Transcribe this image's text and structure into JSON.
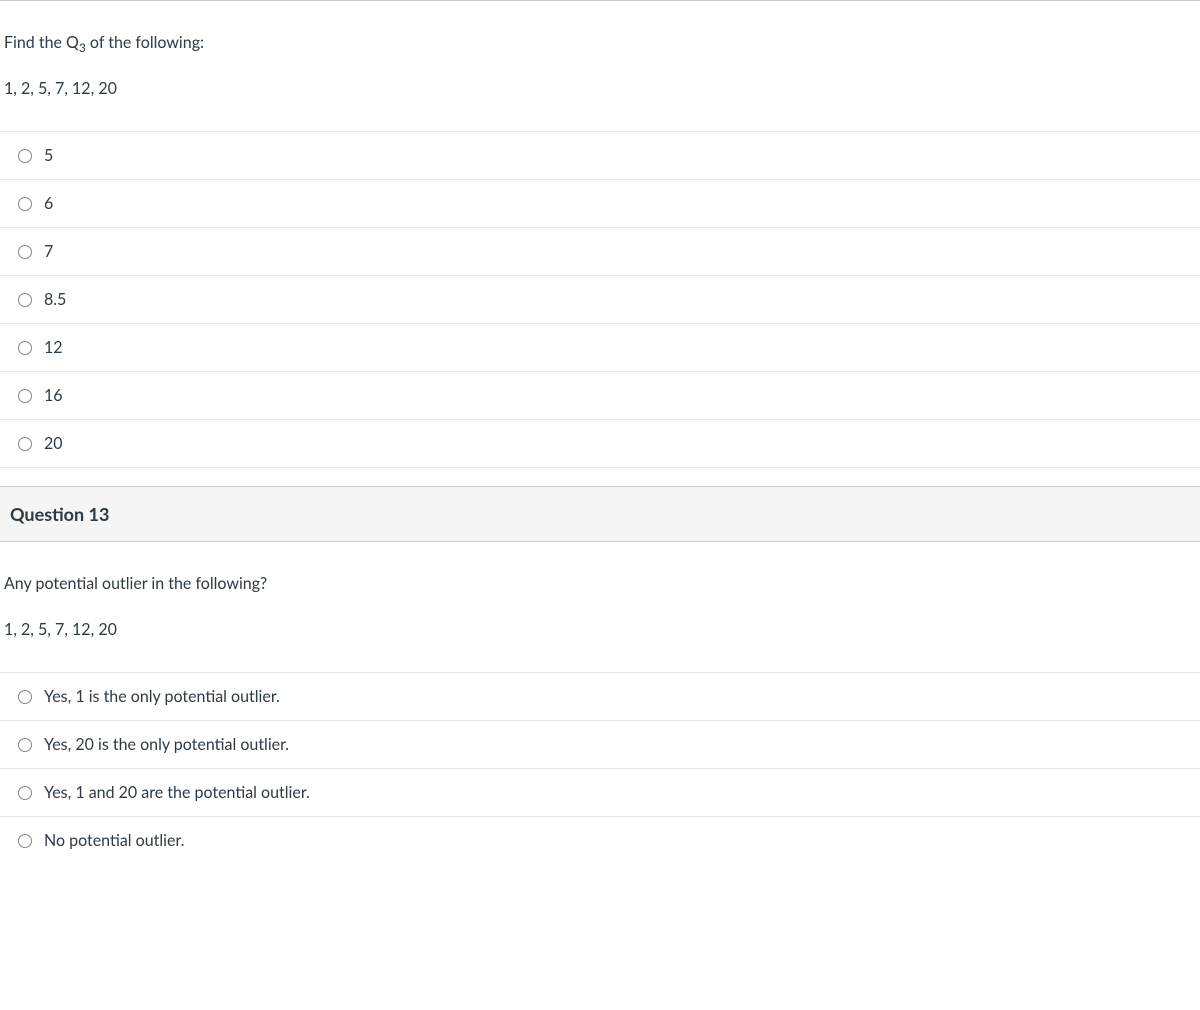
{
  "question1": {
    "prompt_pre": "Find the Q",
    "prompt_sub": "3",
    "prompt_post": " of the following:",
    "data_line": "1, 2, 5, 7, 12, 20",
    "options": [
      "5",
      "6",
      "7",
      "8.5",
      "12",
      "16",
      "20"
    ]
  },
  "question2": {
    "header": "Question 13",
    "prompt": "Any potential outlier in the following?",
    "data_line": "1, 2, 5, 7, 12, 20",
    "options": [
      "Yes, 1 is the only potential outlier.",
      "Yes, 20 is the only potential outlier.",
      "Yes, 1 and 20 are the potential outlier.",
      "No potential outlier."
    ]
  }
}
